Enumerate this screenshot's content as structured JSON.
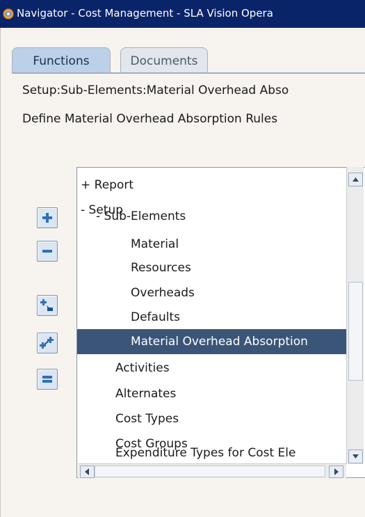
{
  "window": {
    "title": "Navigator - Cost Management - SLA Vision Opera"
  },
  "tabs": [
    {
      "label": "Functions",
      "active": true
    },
    {
      "label": "Documents",
      "active": false
    }
  ],
  "path_text": "Setup:Sub-Elements:Material Overhead Abso",
  "description": "Define Material Overhead Absorption Rules",
  "tree": {
    "items": [
      {
        "label": "+ Report"
      },
      {
        "label": "- Setup"
      },
      {
        "label": "- Sub-Elements"
      },
      {
        "label": "Material"
      },
      {
        "label": "Resources"
      },
      {
        "label": "Overheads"
      },
      {
        "label": "Defaults"
      },
      {
        "label": "Material Overhead Absorption",
        "selected": true
      },
      {
        "label": "Activities"
      },
      {
        "label": "Alternates"
      },
      {
        "label": "Cost Types"
      },
      {
        "label": "Cost Groups"
      },
      {
        "label": "Expenditure Types for Cost Ele"
      }
    ]
  },
  "side_buttons": [
    {
      "icon": "expand-plus-icon"
    },
    {
      "icon": "collapse-minus-icon"
    },
    {
      "icon": "expand-branch-icon"
    },
    {
      "icon": "expand-all-icon"
    },
    {
      "icon": "collapse-all-icon"
    }
  ],
  "colors": {
    "title_bar": "#0a246a",
    "tab_active": "#bcd1e7",
    "selection": "#3a5577",
    "background": "#f7f3ef"
  }
}
